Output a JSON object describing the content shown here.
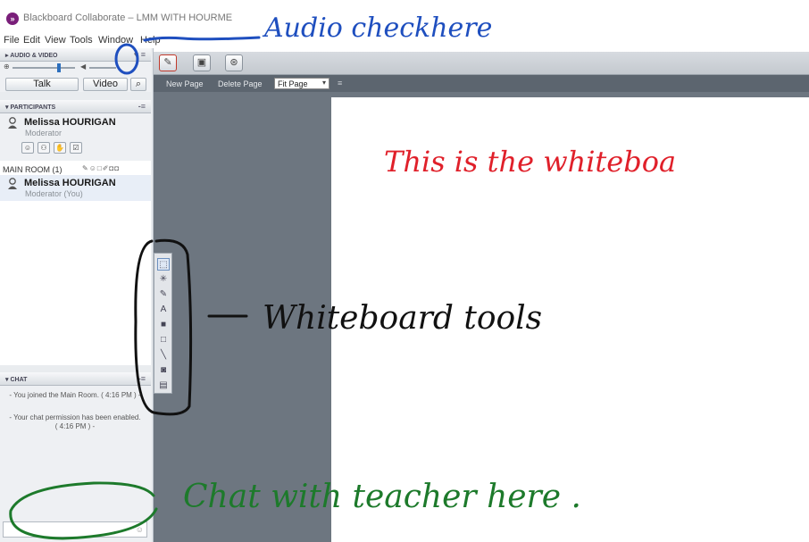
{
  "window": {
    "title": "Blackboard Collaborate – LMM WITH HOURME"
  },
  "menu": [
    "File",
    "Edit",
    "View",
    "Tools",
    "Window",
    "Help"
  ],
  "audio_video": {
    "title": "AUDIO & VIDEO",
    "talk_label": "Talk",
    "video_label": "Video"
  },
  "participants": {
    "title": "PARTICIPANTS",
    "moderator": {
      "name": "Melissa HOURIGAN",
      "role": "Moderator"
    },
    "room": {
      "label": "MAIN ROOM (1)",
      "name": "Melissa HOURIGAN",
      "role": "Moderator (You)"
    }
  },
  "chat": {
    "title": "CHAT",
    "messages": [
      "- You joined the Main Room. ( 4:16 PM ) -",
      "- Your chat permission has been enabled. ( 4:16 PM ) -"
    ]
  },
  "stage": {
    "new_page": "New Page",
    "delete_page": "Delete Page",
    "zoom": "Fit Page"
  },
  "annotations": {
    "audio": "Audio checkhere",
    "whiteboard": "This is the whiteboa",
    "tools": "Whiteboard tools",
    "chat": "Chat with teacher here ."
  },
  "colors": {
    "blue_ink": "#1f4fbf",
    "red_ink": "#e0202a",
    "black_ink": "#111111",
    "green_ink": "#1d7a2b",
    "accent": "#2d6fbd"
  }
}
